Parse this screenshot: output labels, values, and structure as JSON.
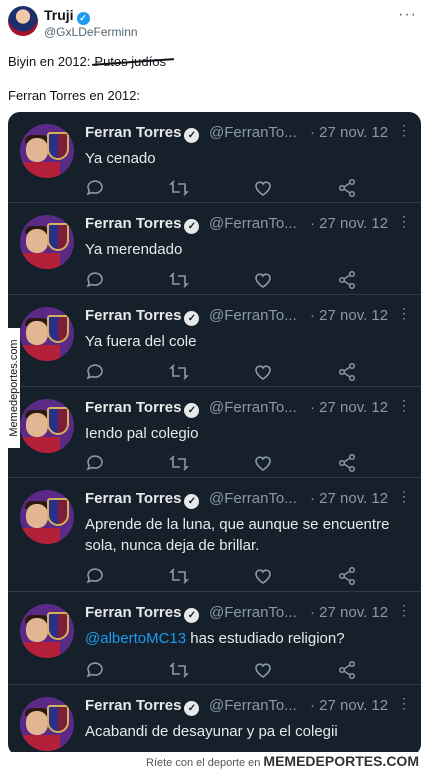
{
  "post": {
    "author_name": "Truji",
    "author_handle": "@GxLDeFerminn",
    "line1_prefix": "Biyin en 2012:",
    "line1_struck": "Putos judíos",
    "line2": "Ferran Torres en 2012:"
  },
  "tweets": [
    {
      "name": "Ferran Torres",
      "handle": "@FerranTo...",
      "date": "· 27 nov. 12",
      "text": "Ya cenado"
    },
    {
      "name": "Ferran Torres",
      "handle": "@FerranTo...",
      "date": "· 27 nov. 12",
      "text": "Ya merendado"
    },
    {
      "name": "Ferran Torres",
      "handle": "@FerranTo...",
      "date": "· 27 nov. 12",
      "text": "Ya fuera del cole"
    },
    {
      "name": "Ferran Torres",
      "handle": "@FerranTo...",
      "date": "· 27 nov. 12",
      "text": "Iendo pal colegio"
    },
    {
      "name": "Ferran Torres",
      "handle": "@FerranTo...",
      "date": "· 27 nov. 12",
      "text": "Aprende de la luna, que aunque se encuentre sola, nunca deja de brillar."
    },
    {
      "name": "Ferran Torres",
      "handle": "@FerranTo...",
      "date": "· 27 nov. 12",
      "mention": "@albertoMC13",
      "text": " has estudiado religion?"
    },
    {
      "name": "Ferran Torres",
      "handle": "@FerranTo...",
      "date": "· 27 nov. 12",
      "text": "Acabandi de desayunar y pa el colegii"
    }
  ],
  "icons": {
    "reply": "reply-icon",
    "retweet": "retweet-icon",
    "like": "heart-icon",
    "share": "share-icon",
    "more": "more-icon",
    "verified": "verified-badge-icon"
  },
  "watermark": {
    "side_text": "Memedeportes.com",
    "footer_text": "Ríete con el deporte en",
    "footer_brand": "MEMEDEPORTES.COM"
  },
  "colors": {
    "quote_bg": "#15202b",
    "accent": "#1d9bf0",
    "text_dim": "#8b98a5"
  }
}
